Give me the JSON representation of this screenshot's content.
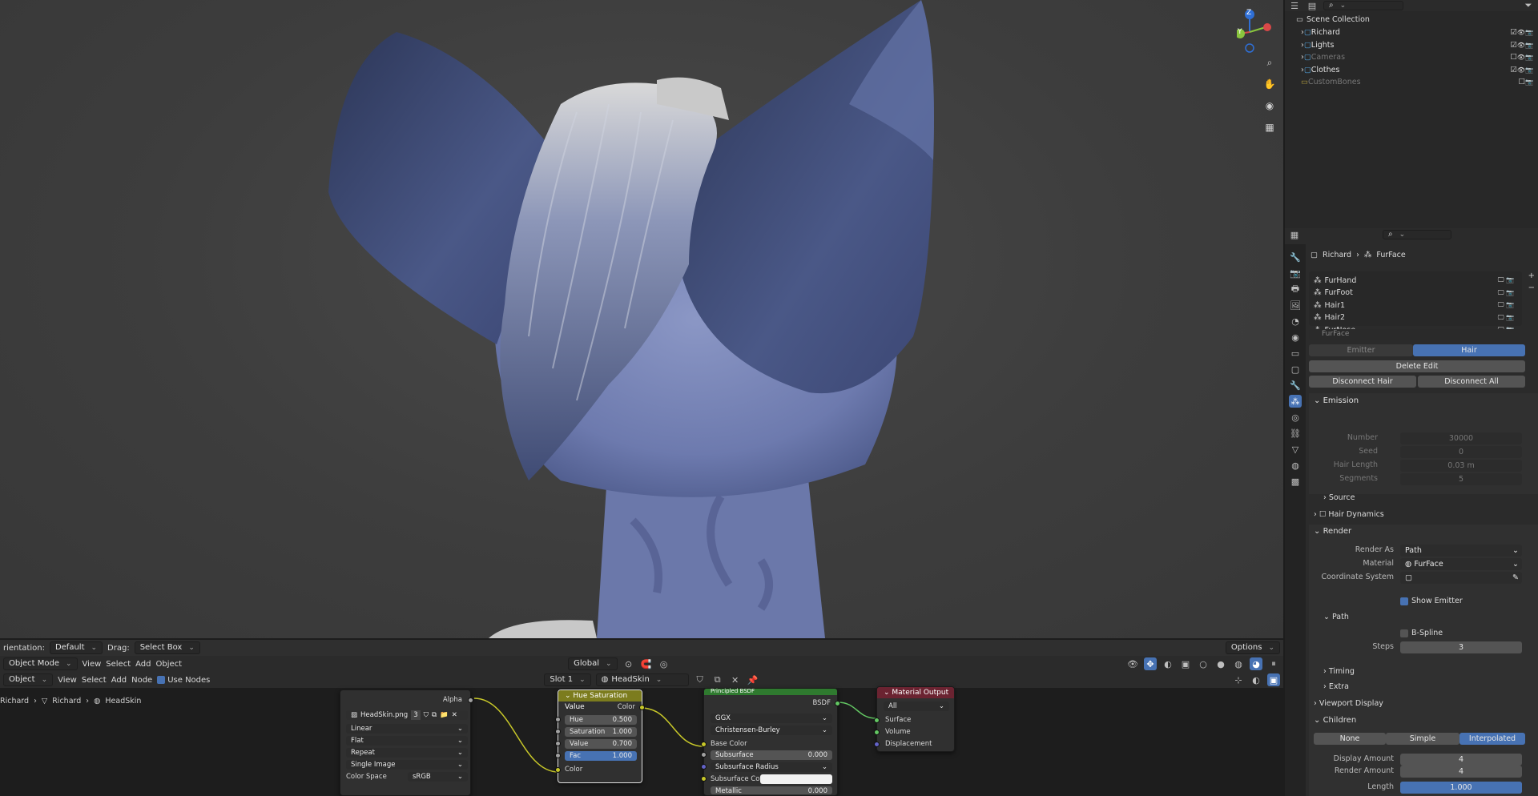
{
  "viewport": {
    "header": {
      "orientation_label": "rientation:",
      "orientation_value": "Default",
      "drag_label": "Drag:",
      "drag_value": "Select Box",
      "options_label": "Options"
    }
  },
  "toolbar": {
    "transform_orientation": "Global"
  },
  "node_editor": {
    "header": {
      "editor_type": "Object",
      "menus": [
        "View",
        "Select",
        "Add",
        "Node"
      ],
      "use_nodes_label": "Use Nodes",
      "slot": "Slot 1",
      "material_name": "HeadSkin"
    },
    "editor_mode": "Object Mode",
    "mode_menus": [
      "View",
      "Select",
      "Add",
      "Object"
    ],
    "breadcrumb": [
      "Richard",
      "Richard",
      "HeadSkin"
    ],
    "image_node": {
      "alpha_label": "Alpha",
      "color_label": "Color",
      "image_name": "HeadSkin.png",
      "user_count": "3",
      "interpolation": "Linear",
      "projection": "Flat",
      "extension": "Repeat",
      "source": "Single Image",
      "color_space_label": "Color Space",
      "color_space": "sRGB"
    },
    "hsv_node": {
      "title": "Hue Saturation Value",
      "output": "Color",
      "hue_label": "Hue",
      "hue": "0.500",
      "saturation_label": "Saturation",
      "saturation": "1.000",
      "value_label": "Value",
      "value": "0.700",
      "fac_label": "Fac",
      "fac": "1.000",
      "input_color": "Color"
    },
    "bsdf_node": {
      "title": "Principled BSDF",
      "output": "BSDF",
      "distribution": "GGX",
      "subsurface_method": "Christensen-Burley",
      "base_color_label": "Base Color",
      "subsurface_label": "Subsurface",
      "subsurface": "0.000",
      "subsurface_radius": "Subsurface Radius",
      "subsurface_color": "Subsurface Co...",
      "metallic_label": "Metallic",
      "metallic": "0.000"
    },
    "output_node": {
      "title": "Material Output",
      "target": "All",
      "surface": "Surface",
      "volume": "Volume",
      "displacement": "Displacement"
    }
  },
  "outliner": {
    "root": "Scene Collection",
    "items": [
      {
        "name": "Richard",
        "dim": false
      },
      {
        "name": "Lights",
        "dim": false
      },
      {
        "name": "Cameras",
        "dim": true
      },
      {
        "name": "Clothes",
        "dim": false
      },
      {
        "name": "CustomBones",
        "dim": true
      }
    ]
  },
  "properties": {
    "breadcrumb": [
      "Richard",
      "FurFace"
    ],
    "particle_systems": [
      "FurHand",
      "FurFoot",
      "Hair1",
      "Hair2",
      "FurNose"
    ],
    "active_system": "FurFace",
    "type_tabs": [
      "Emitter",
      "Hair"
    ],
    "active_type": "Hair",
    "delete_edit": "Delete Edit",
    "disconnect_hair": "Disconnect Hair",
    "disconnect_all": "Disconnect All",
    "emission": {
      "title": "Emission",
      "number_label": "Number",
      "number": "30000",
      "seed_label": "Seed",
      "seed": "0",
      "hair_length_label": "Hair Length",
      "hair_length": "0.03 m",
      "segments_label": "Segments",
      "segments": "5"
    },
    "source_label": "Source",
    "hair_dynamics_label": "Hair Dynamics",
    "render": {
      "title": "Render",
      "render_as_label": "Render As",
      "render_as": "Path",
      "material_label": "Material",
      "material": "FurFace",
      "coordinate_system_label": "Coordinate System",
      "show_emitter_label": "Show Emitter"
    },
    "path": {
      "title": "Path",
      "bspline_label": "B-Spline",
      "steps_label": "Steps",
      "steps": "3"
    },
    "timing_label": "Timing",
    "extra_label": "Extra",
    "viewport_display_label": "Viewport Display",
    "children": {
      "title": "Children",
      "tabs": [
        "None",
        "Simple",
        "Interpolated"
      ],
      "active": "Interpolated",
      "display_amount_label": "Display Amount",
      "display_amount": "4",
      "render_amount_label": "Render Amount",
      "render_amount": "4",
      "length_label": "Length",
      "length": "1.000",
      "length_fraction": 1.0
    }
  },
  "gizmo": {
    "axis_z": "Z",
    "axis_y": "Y"
  },
  "colors": {
    "accent": "#4772b3",
    "hsv_header": "#7c7c1e",
    "bsdf_header": "#2f7a2f",
    "output_header": "#6b2331",
    "socket_yellow": "#c7c729",
    "socket_green": "#63c763",
    "socket_purple": "#6363c7",
    "socket_gray": "#a1a1a1"
  }
}
